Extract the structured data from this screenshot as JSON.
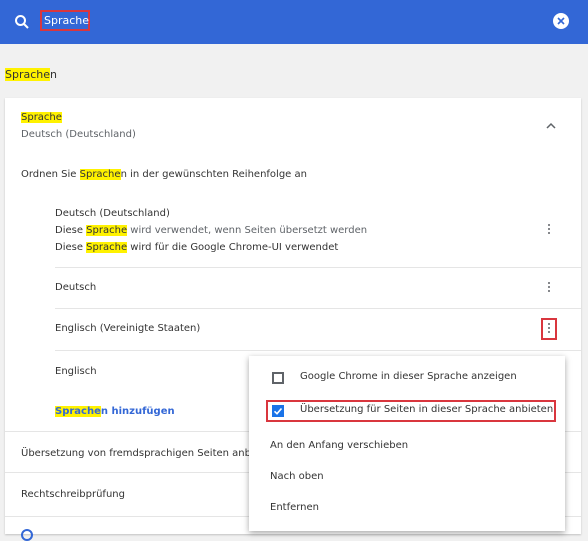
{
  "search": {
    "value": "Sprache"
  },
  "section": {
    "title_hl": "Sprache",
    "title_rest": "n"
  },
  "language_card": {
    "heading": "Sprache",
    "subheading": "Deutsch (Deutschland)",
    "order_prefix": "Ordnen Sie ",
    "order_hl": "Sprache",
    "order_rest": "n in der gewünschten Reihenfolge an",
    "languages": [
      {
        "name": "Deutsch (Deutschland)",
        "line1_prefix": "Diese ",
        "line1_hl": "Sprache",
        "line1_rest": " wird verwendet, wenn Seiten übersetzt werden",
        "line2_prefix": "Diese ",
        "line2_hl": "Sprache",
        "line2_rest": " wird für die Google Chrome-UI verwendet"
      },
      {
        "name": "Deutsch"
      },
      {
        "name": "Englisch (Vereinigte Staaten)"
      },
      {
        "name": "Englisch"
      }
    ],
    "add_hl": "Sprache",
    "add_rest": "n hinzufügen",
    "translate_offer": "Übersetzung von fremdsprachigen Seiten anbie",
    "spellcheck": "Rechtschreibprüfung"
  },
  "menu": {
    "items": [
      {
        "label": "Google Chrome in dieser Sprache anzeigen",
        "checked": false
      },
      {
        "label": "Übersetzung für Seiten in dieser Sprache anbieten",
        "checked": true
      },
      {
        "label": "An den Anfang verschieben"
      },
      {
        "label": "Nach oben"
      },
      {
        "label": "Entfernen"
      }
    ]
  },
  "colors": {
    "header": "#3367d6",
    "highlight": "#fff200",
    "annotation": "#d9363e",
    "checkbox": "#1a73e8"
  }
}
